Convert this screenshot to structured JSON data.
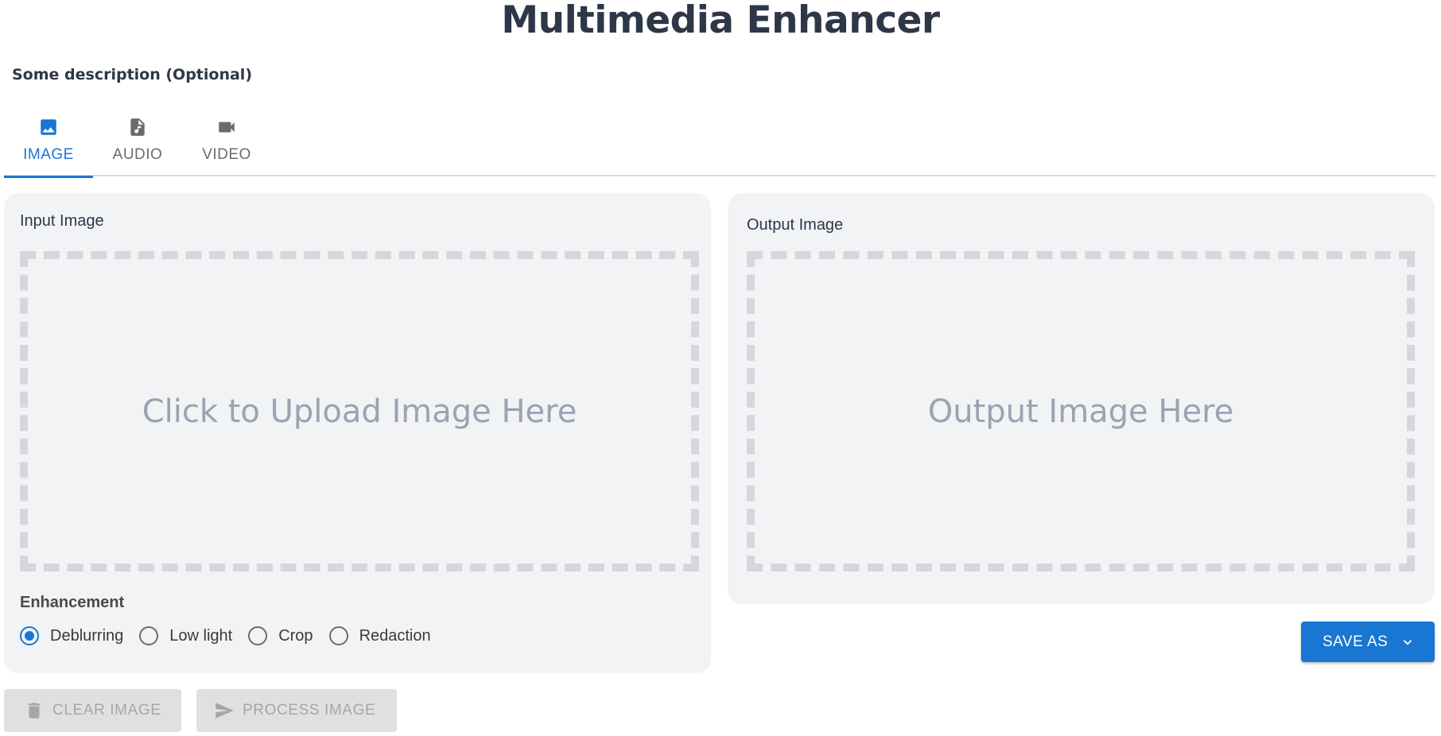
{
  "header": {
    "title": "Multimedia Enhancer",
    "description": "Some description (Optional)"
  },
  "tabs": [
    {
      "label": "IMAGE",
      "icon": "image-icon",
      "active": true
    },
    {
      "label": "AUDIO",
      "icon": "audio-file-icon",
      "active": false
    },
    {
      "label": "VIDEO",
      "icon": "videocam-icon",
      "active": false
    }
  ],
  "input_panel": {
    "label": "Input Image",
    "dropzone_text": "Click to Upload Image Here",
    "enhancement_label": "Enhancement",
    "options": [
      {
        "label": "Deblurring",
        "checked": true
      },
      {
        "label": "Low light",
        "checked": false
      },
      {
        "label": "Crop",
        "checked": false
      },
      {
        "label": "Redaction",
        "checked": false
      }
    ]
  },
  "output_panel": {
    "label": "Output Image",
    "placeholder_text": "Output Image Here"
  },
  "actions": {
    "clear_label": "CLEAR IMAGE",
    "clear_icon": "trash-icon",
    "process_label": "PROCESS IMAGE",
    "process_icon": "send-icon",
    "save_label": "SAVE AS",
    "save_icon": "chevron-down-icon"
  },
  "colors": {
    "accent": "#1976d2",
    "panel_bg": "#f2f3f5",
    "disabled_bg": "#e0e0e0"
  }
}
